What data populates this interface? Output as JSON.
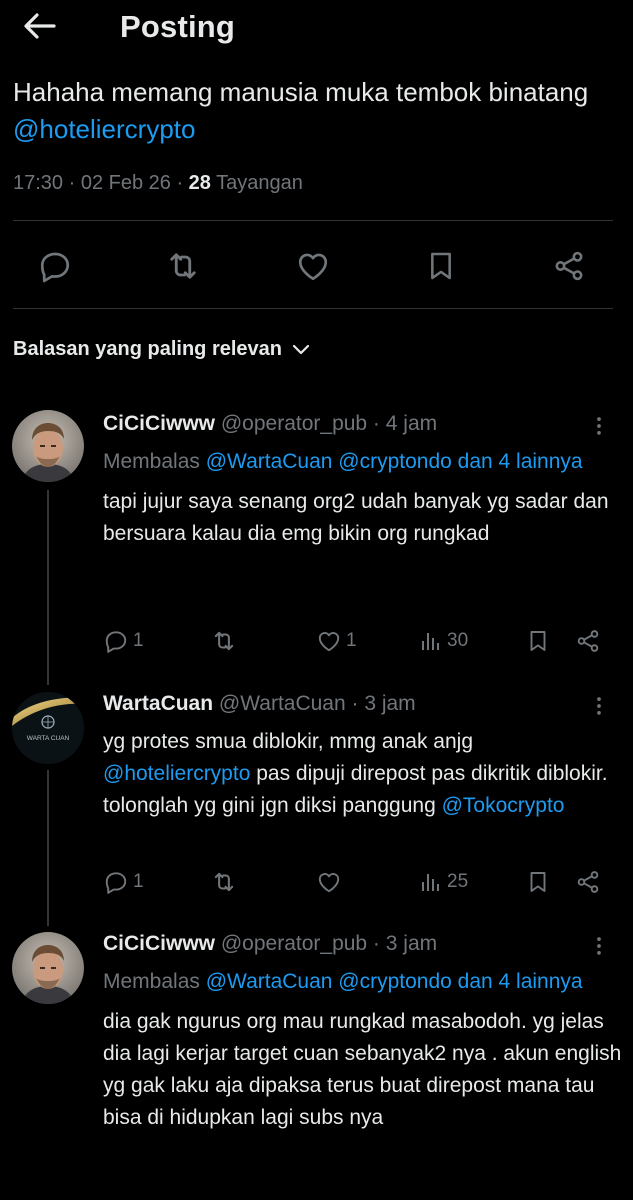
{
  "header": {
    "title": "Posting"
  },
  "post": {
    "text_1": "Hahaha memang manusia muka tembok binatang ",
    "mention": "@hoteliercrypto",
    "time": "17:30 · 02 Feb 26 · ",
    "views": "28",
    "views_label": " Tayangan"
  },
  "sort": {
    "label": "Balasan yang paling relevan"
  },
  "replies": [
    {
      "name": "CiCiCiwww",
      "handle": " @operator_pub · 4 jam",
      "replying_prefix": "Membalas ",
      "replying_mentions": "@WartaCuan @cryptondo dan 4 lainnya",
      "text": "tapi jujur saya senang org2 udah banyak yg sadar dan bersuara kalau dia emg bikin org rungkad",
      "reply_count": "1",
      "like_count": "1",
      "view_count": "30"
    },
    {
      "name": "WartaCuan",
      "handle": " @WartaCuan · 3 jam",
      "avatar_text": "WARTA CUAN",
      "text_1": "yg protes smua diblokir, mmg anak anjg ",
      "mention_1": "@hoteliercrypto",
      "text_2": " pas dipuji direpost pas dikritik diblokir. tolonglah yg gini jgn diksi panggung ",
      "mention_2": "@Tokocrypto",
      "reply_count": "1",
      "view_count": "25"
    },
    {
      "name": "CiCiCiwww",
      "handle": " @operator_pub · 3 jam",
      "replying_prefix": "Membalas ",
      "replying_mentions": "@WartaCuan @cryptondo dan 4 lainnya",
      "text": "dia gak ngurus org mau rungkad masabodoh. yg jelas dia lagi kerjar target cuan sebanyak2 nya . akun english yg gak laku aja dipaksa terus buat direpost mana tau bisa di hidupkan lagi subs nya"
    }
  ],
  "colors": {
    "accent": "#1d9bf0",
    "muted": "#71767b",
    "text": "#e7e9ea",
    "background": "#000000"
  }
}
